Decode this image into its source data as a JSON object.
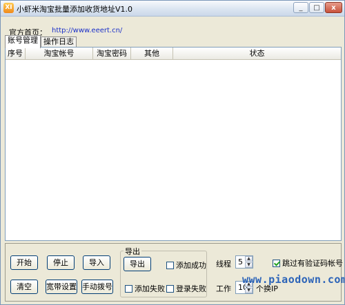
{
  "window": {
    "title": "小虾米淘宝批量添加收货地址V1.0",
    "icon_text": "XI",
    "controls": {
      "minimize": "_",
      "maximize": "□",
      "close": "x"
    }
  },
  "homepage": {
    "label": "官方首页：",
    "url": "http://www.eeert.cn/"
  },
  "tabs": [
    {
      "label": "账号管理",
      "active": true
    },
    {
      "label": "操作日志",
      "active": false
    }
  ],
  "grid": {
    "columns": [
      "序号",
      "淘宝帐号",
      "淘宝密码",
      "其他",
      "状态"
    ],
    "rows": []
  },
  "buttons": {
    "start": "开始",
    "stop": "停止",
    "import": "导入",
    "clear": "清空",
    "broadband": "宽带设置",
    "manual_dial": "手动拨号"
  },
  "export_group": {
    "title": "导出",
    "export_button": "导出",
    "add_success": {
      "label": "添加成功",
      "checked": false
    },
    "add_fail": {
      "label": "添加失败",
      "checked": false
    },
    "login_fail": {
      "label": "登录失败",
      "checked": false
    }
  },
  "threads": {
    "label": "线程",
    "value": "5"
  },
  "work": {
    "label": "工作",
    "value": "10",
    "suffix": "个换IP"
  },
  "skip_captcha": {
    "label": "跳过有验证码帐号",
    "checked": true
  },
  "watermark": "www.piaodown.com",
  "colors": {
    "title_bar": "#dbe5f1",
    "link": "#1a2fc8",
    "watermark": "#2b63b8",
    "face": "#ece9d8"
  }
}
